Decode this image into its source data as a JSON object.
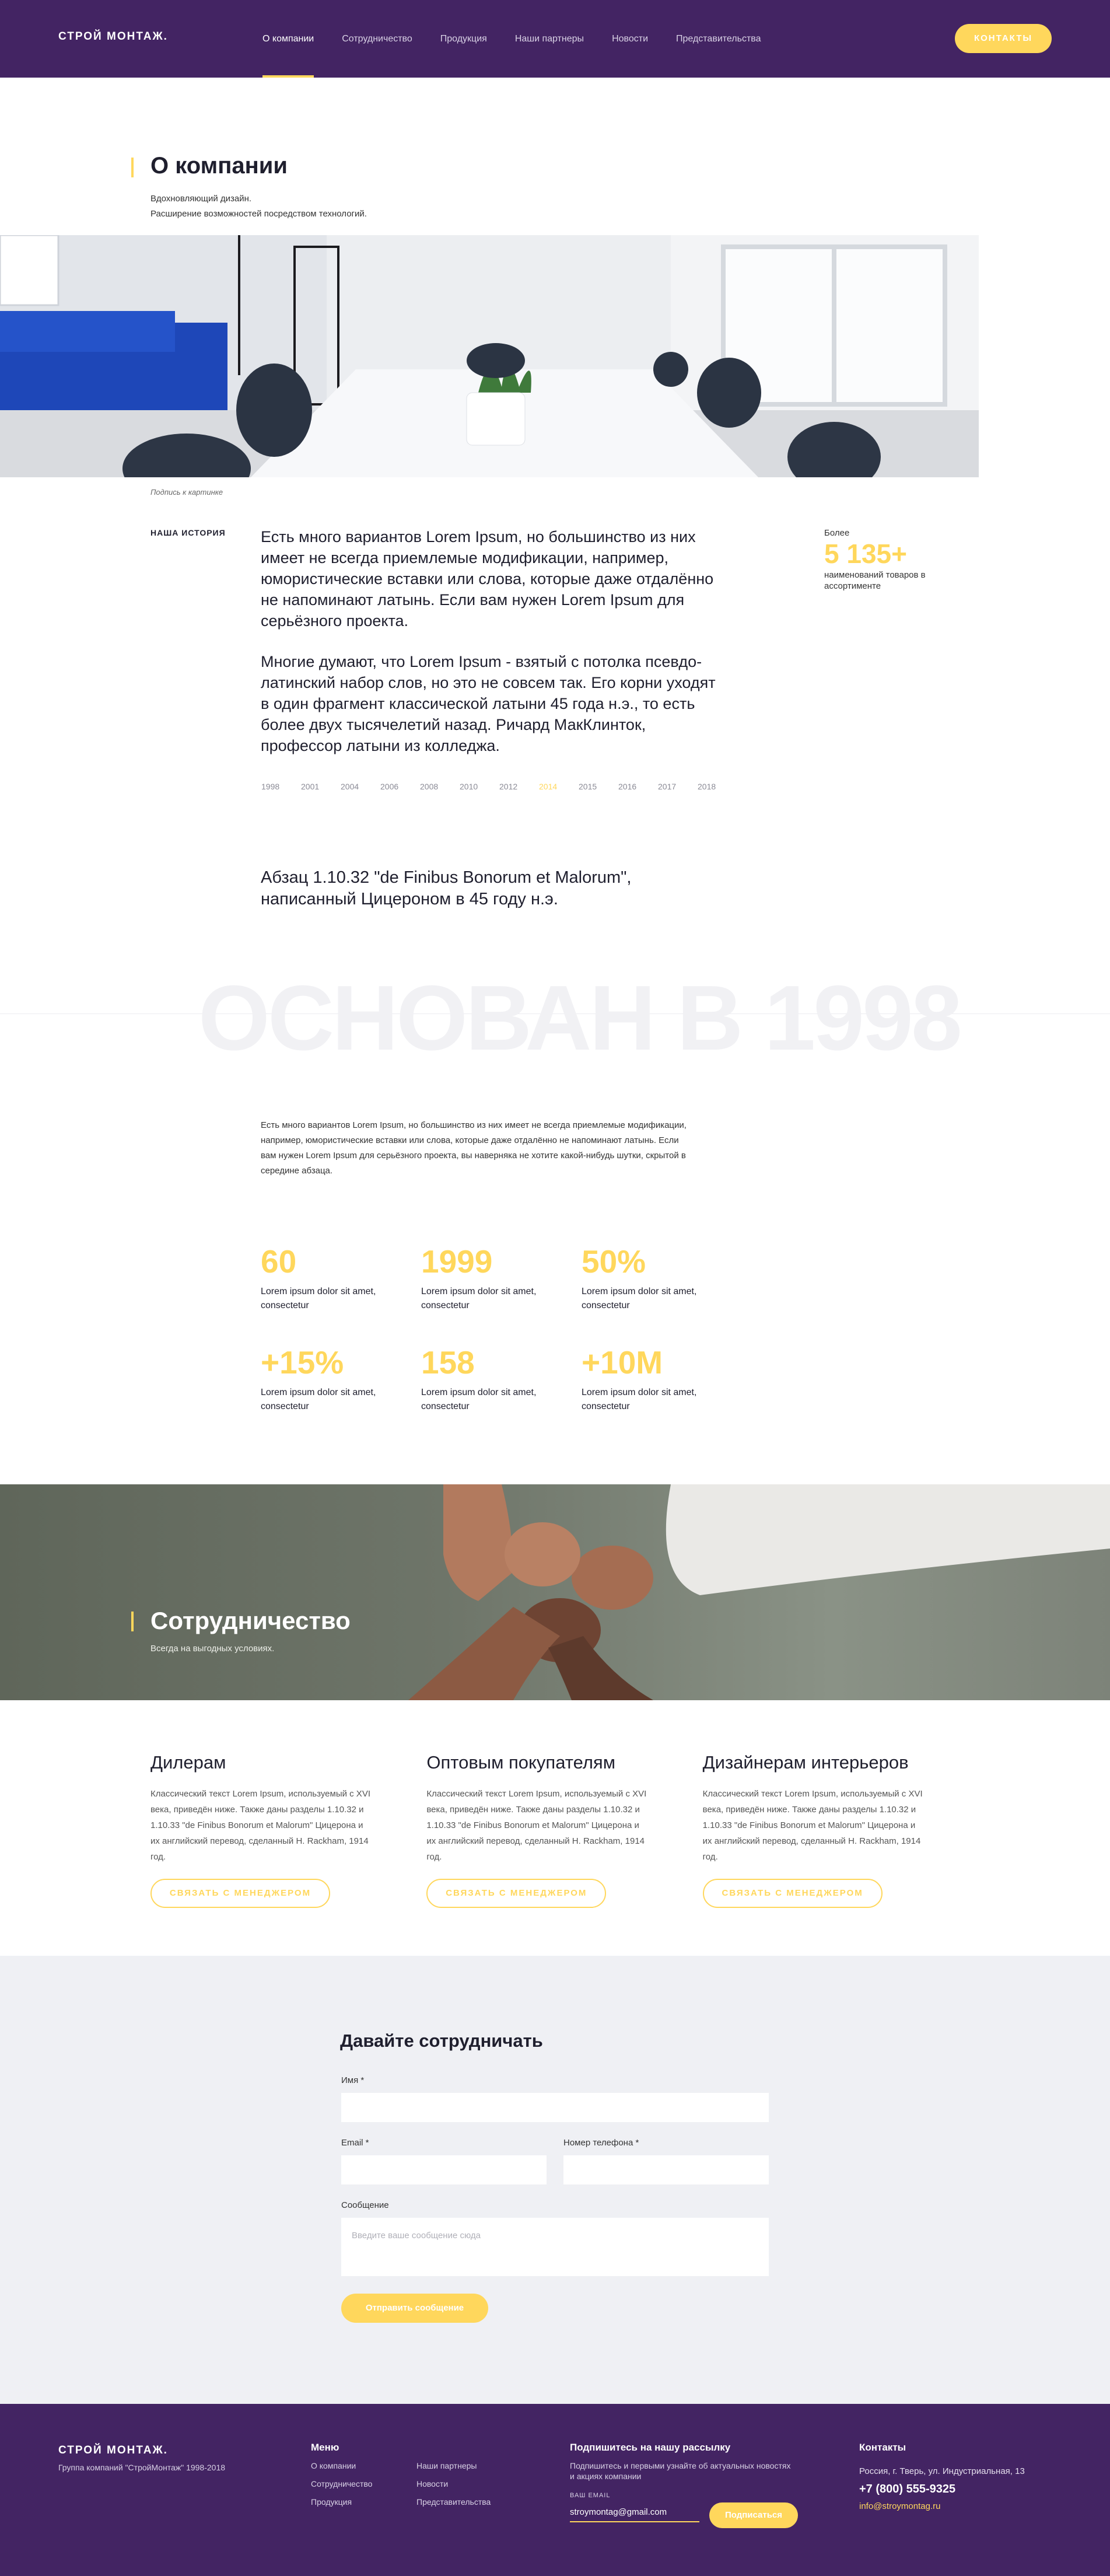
{
  "header": {
    "logo": "СТРОЙ МОНТАЖ.",
    "nav": [
      "О компании",
      "Сотрудничество",
      "Продукция",
      "Наши партнеры",
      "Новости",
      "Представительства"
    ],
    "contacts_button": "КОНТАКТЫ"
  },
  "about": {
    "title": "О компании",
    "subtitle_1": "Вдохновляющий дизайн.",
    "subtitle_2": "Расширение возможностей посредством технологий.",
    "caption": "Подпись к картинке",
    "story_label": "НАША ИСТОРИЯ",
    "story_p1": "Есть много вариантов Lorem Ipsum, но большинство из них имеет не всегда приемлемые модификации, например, юмористические вставки или слова, которые даже отдалённо не напоминают латынь. Если вам нужен Lorem Ipsum для серьёзного проекта.",
    "story_p2": "Многие думают, что Lorem Ipsum - взятый с потолка псевдо-латинский набор слов, но это не совсем так. Его корни уходят в один фрагмент классической латыни 45 года н.э., то есть более двух тысячелетий назад. Ричард МакКлинток, профессор латыни из колледжа.",
    "more_label": "Более",
    "more_number": "5 135+",
    "more_desc": "наименований товаров в ассортименте",
    "years": [
      "1998",
      "2001",
      "2004",
      "2006",
      "2008",
      "2010",
      "2012",
      "2014",
      "2015",
      "2016",
      "2017",
      "2018"
    ],
    "active_year": "2014",
    "paragraph_title": "Абзац 1.10.32 \"de Finibus Bonorum et Malorum\", написанный Цицероном в 45 году н.э.",
    "founded": "ОСНОВАН В 1998",
    "founded_text": "Есть много вариантов Lorem Ipsum, но большинство из них имеет не всегда приемлемые модификации, например, юмористические вставки или слова, которые даже отдалённо не напоминают латынь. Если вам нужен Lorem Ipsum для серьёзного проекта, вы наверняка не хотите какой-нибудь шутки, скрытой в середине абзаца.",
    "stats": [
      {
        "num": "60",
        "desc": "Lorem ipsum dolor sit amet, consectetur"
      },
      {
        "num": "1999",
        "desc": "Lorem ipsum dolor sit amet, consectetur"
      },
      {
        "num": "50%",
        "desc": "Lorem ipsum dolor sit amet, consectetur"
      },
      {
        "num": "+15%",
        "desc": "Lorem ipsum dolor sit amet, consectetur"
      },
      {
        "num": "158",
        "desc": "Lorem ipsum dolor sit amet, consectetur"
      },
      {
        "num": "+10M",
        "desc": "Lorem ipsum dolor sit amet, consectetur"
      }
    ]
  },
  "coop": {
    "title": "Сотрудничество",
    "subtitle": "Всегда на выгодных условиях.",
    "cards": [
      {
        "title": "Дилерам",
        "text": "Классический текст Lorem Ipsum, используемый с XVI века, приведён ниже. Также даны разделы 1.10.32 и 1.10.33 \"de Finibus Bonorum et Malorum\" Цицерона и их английский перевод, сделанный H. Rackham, 1914 год.",
        "button": "СВЯЗАТЬ С МЕНЕДЖЕРОМ"
      },
      {
        "title": "Оптовым покупателям",
        "text": "Классический текст Lorem Ipsum, используемый с XVI века, приведён ниже. Также даны разделы 1.10.32 и 1.10.33 \"de Finibus Bonorum et Malorum\" Цицерона и их английский перевод, сделанный H. Rackham, 1914 год.",
        "button": "СВЯЗАТЬ С МЕНЕДЖЕРОМ"
      },
      {
        "title": "Дизайнерам интерьеров",
        "text": "Классический текст Lorem Ipsum, используемый с XVI века, приведён ниже. Также даны разделы 1.10.32 и 1.10.33 \"de Finibus Bonorum et Malorum\" Цицерона и их английский перевод, сделанный H. Rackham, 1914 год.",
        "button": "СВЯЗАТЬ С МЕНЕДЖЕРОМ"
      }
    ]
  },
  "form": {
    "title": "Давайте сотрудничать",
    "name_label": "Имя *",
    "email_label": "Email *",
    "phone_label": "Номер телефона *",
    "message_label": "Сообщение",
    "message_placeholder": "Введите ваше сообщение сюда",
    "submit": "Отправить сообщение"
  },
  "footer": {
    "logo": "СТРОЙ МОНТАЖ.",
    "copyright": "Группа компаний \"СтройМонтаж\" 1998-2018",
    "menu_title": "Меню",
    "menu_col1": [
      "О компании",
      "Сотрудничество",
      "Продукция"
    ],
    "menu_col2": [
      "Наши партнеры",
      "Новости",
      "Представительства"
    ],
    "subscribe_title": "Подпишитесь на нашу рассылку",
    "subscribe_note": "Подпишитесь и первыми узнайте об актуальных новостях и акциях компании",
    "email_label": "ВАШ EMAIL",
    "email_value": "stroymontag@gmail.com",
    "subscribe_button": "Подписаться",
    "contacts_title": "Контакты",
    "address": "Россия, г. Тверь, ул. Индустриальная, 13",
    "phone": "+7 (800) 555-9325",
    "email": "info@stroymontag.ru"
  },
  "colors": {
    "primary": "#432463",
    "accent": "#ffd75c"
  }
}
